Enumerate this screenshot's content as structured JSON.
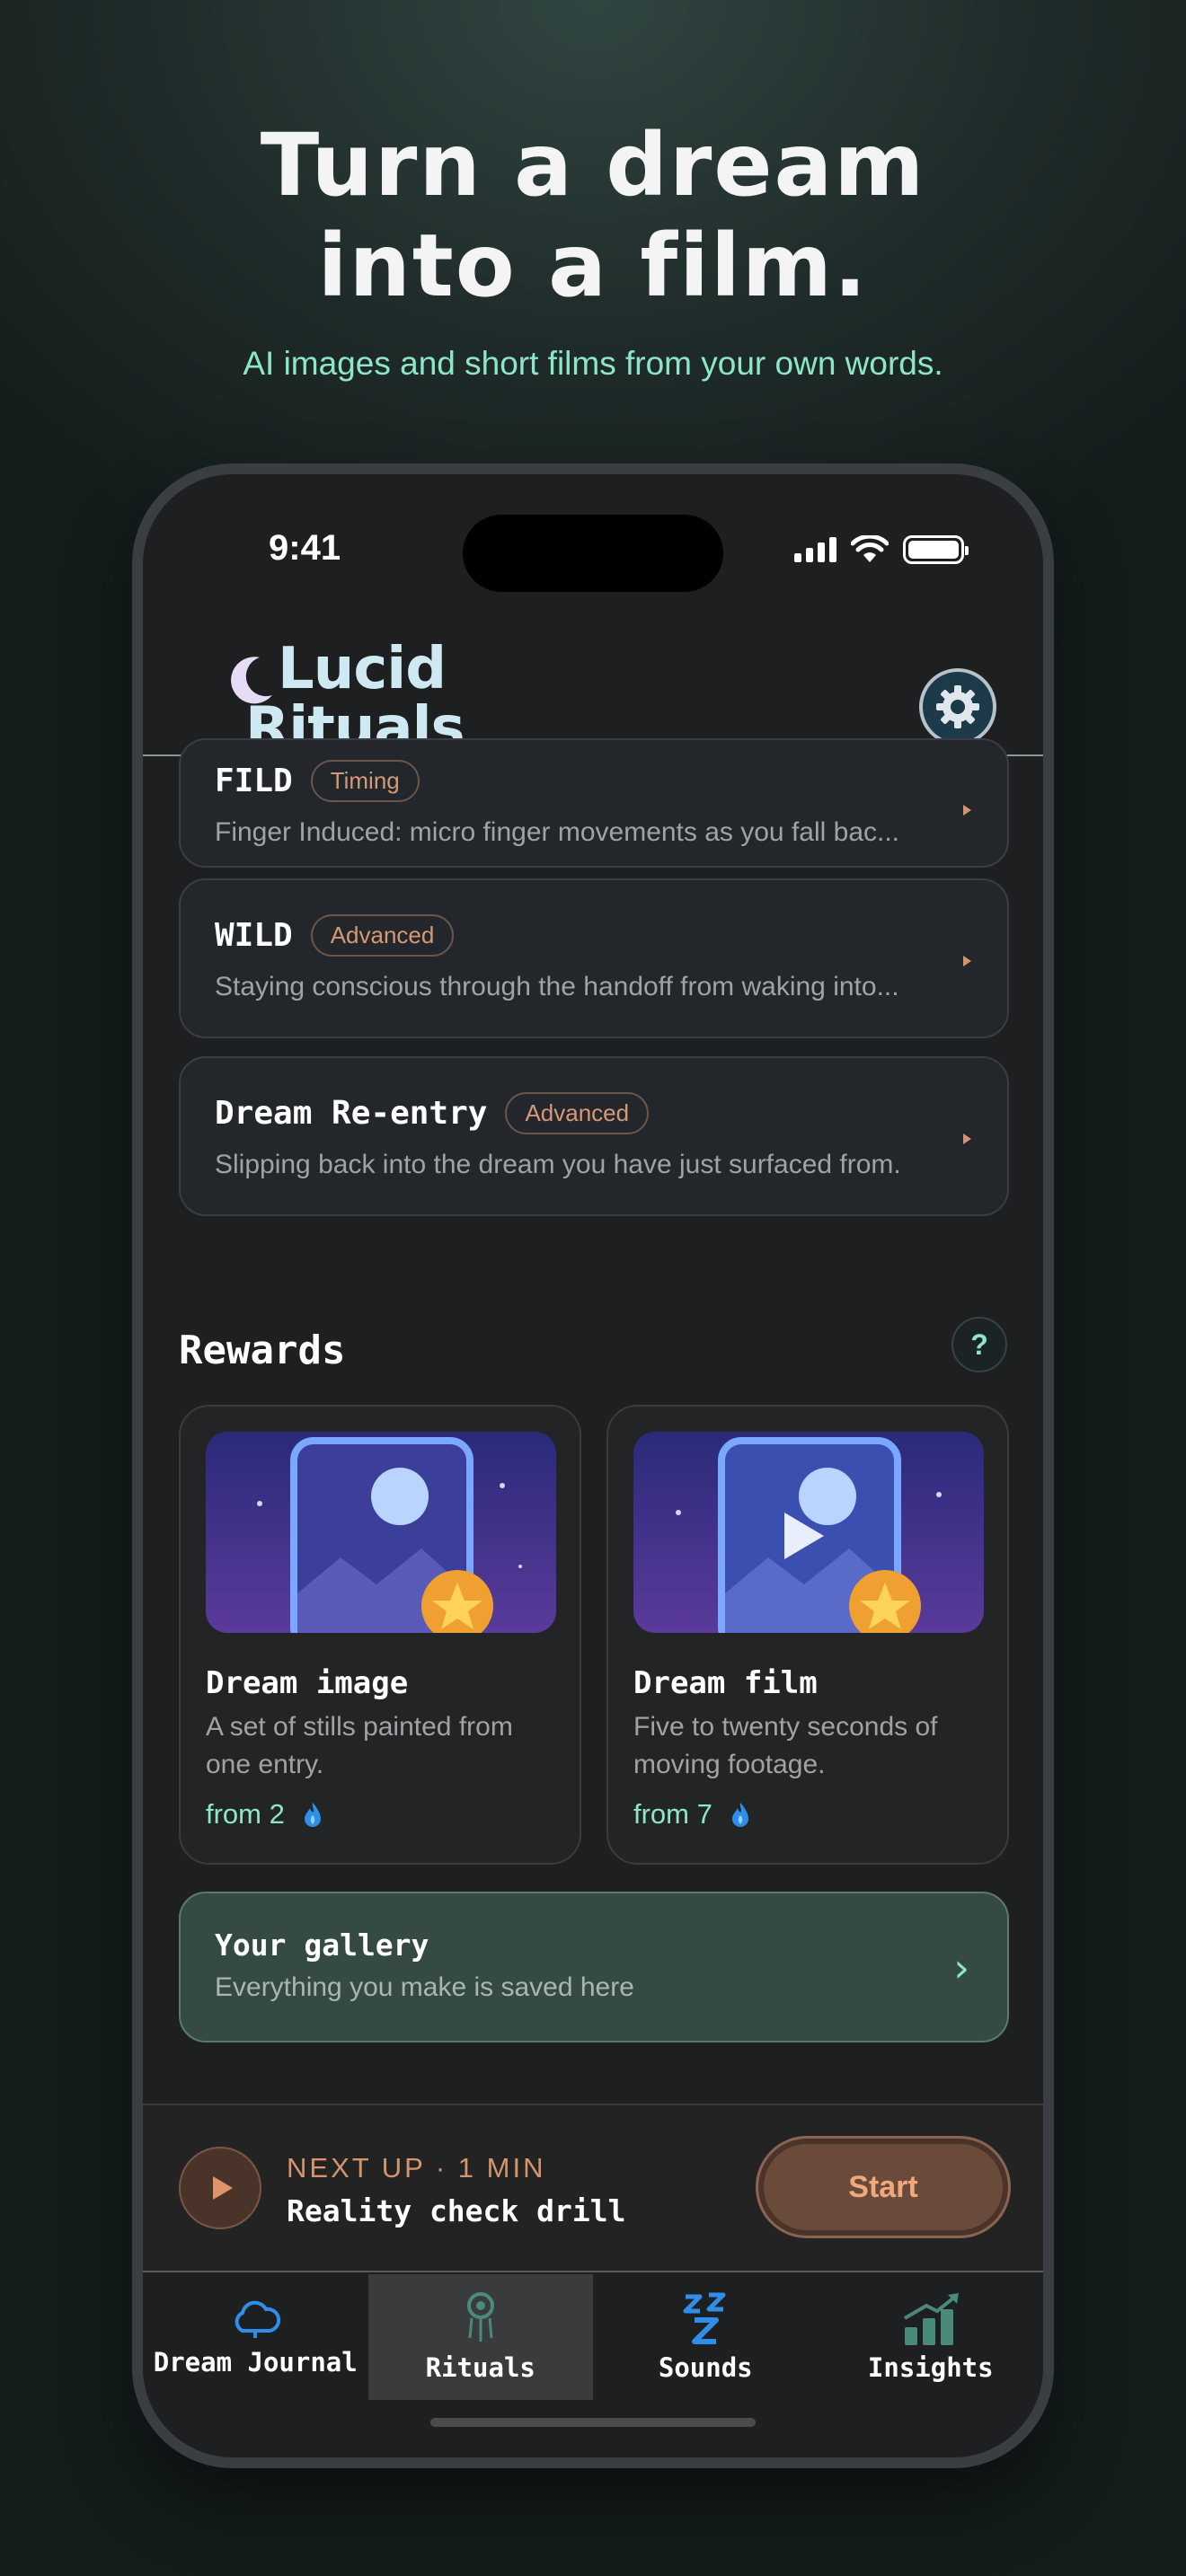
{
  "promo": {
    "headline_line1": "Turn a dream",
    "headline_line2": "into a film.",
    "subline": "AI images and short films from your own words."
  },
  "status_bar": {
    "time": "9:41"
  },
  "header": {
    "logo_line1": "Lucid",
    "logo_line2": "Rituals"
  },
  "techniques": [
    {
      "name": "FILD",
      "tag": "Timing",
      "desc": "Finger Induced: micro finger movements as you fall bac..."
    },
    {
      "name": "WILD",
      "tag": "Advanced",
      "desc": "Staying conscious through the handoff from waking into..."
    },
    {
      "name": "Dream Re-entry",
      "tag": "Advanced",
      "desc": "Slipping back into the dream you have just surfaced from."
    }
  ],
  "rewards": {
    "title": "Rewards",
    "help": "?",
    "items": [
      {
        "name": "Dream image",
        "desc": "A set of stills painted from one entry.",
        "cost": "from 2"
      },
      {
        "name": "Dream film",
        "desc": "Five to twenty seconds of moving footage.",
        "cost": "from 7"
      }
    ]
  },
  "gallery": {
    "title": "Your gallery",
    "subtitle": "Everything you make is saved here",
    "chevron": "›"
  },
  "next_up": {
    "label": "NEXT UP · 1 MIN",
    "name": "Reality check drill",
    "start": "Start"
  },
  "tabs": [
    {
      "label": "Dream Journal",
      "icon": "cloud-icon"
    },
    {
      "label": "Rituals",
      "icon": "dreamcatcher-icon",
      "active": true
    },
    {
      "label": "Sounds",
      "icon": "zzz-icon"
    },
    {
      "label": "Insights",
      "icon": "chart-icon"
    }
  ],
  "colors": {
    "accent_mint": "#8ee6c9",
    "accent_orange": "#d4956e",
    "flame_blue": "#2f8fe8"
  }
}
